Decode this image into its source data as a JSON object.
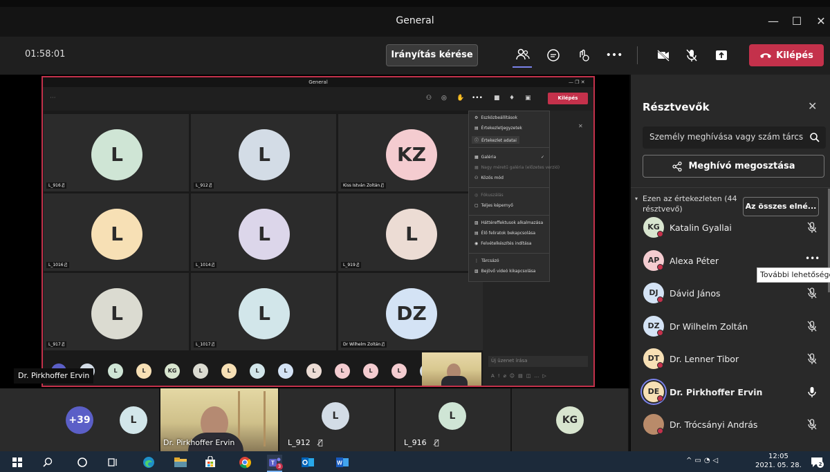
{
  "window": {
    "title": "General"
  },
  "toolbar": {
    "timer": "01:58:01",
    "control_request_label": "Irányítás kérése",
    "more_label": "•••",
    "leave_label": "Kilépés"
  },
  "shared_screen": {
    "title": "General",
    "leave_label": "Kilépés",
    "tiles": [
      {
        "initials": "L",
        "name": "L_916",
        "color": "#cfe5d5"
      },
      {
        "initials": "L",
        "name": "L_912",
        "color": "#d3dce6"
      },
      {
        "initials": "KZ",
        "name": "Kiss István Zoltán",
        "color": "#f4ccd0"
      },
      {
        "initials": "L",
        "name": "L_1016",
        "color": "#f7e0b5"
      },
      {
        "initials": "L",
        "name": "L_1014",
        "color": "#dcd6ea"
      },
      {
        "initials": "L",
        "name": "L_919",
        "color": "#ecdcd4"
      },
      {
        "initials": "L",
        "name": "L_917",
        "color": "#dbdbd1"
      },
      {
        "initials": "L",
        "name": "L_1017",
        "color": "#d2e6ea"
      },
      {
        "initials": "DZ",
        "name": "Dr Wilhelm Zoltán",
        "color": "#d4e3f5"
      }
    ],
    "menu_items": [
      "Eszközbeállítások",
      "Értekezletjegyzetek",
      "Értekezlet adatai",
      "Galéria",
      "Nagy méretű galéria (előzetes verzió)",
      "Közös mód",
      "Fókuszálás",
      "Teljes képernyő",
      "Háttéreffektusok alkalmazása",
      "Élő feliratok bekapcsolása",
      "Felvételkészítés indítása",
      "Tárcsázó",
      "Bejövő videó kikapcsolása"
    ],
    "chat_placeholder": "Új üzenet írása"
  },
  "presenter_label": "Dr. Pirkhoffer Ervin",
  "bottom_strip": {
    "overflow_count": "+39",
    "tile_1_initials": "L",
    "video_name": "Dr. Pirkhoffer Ervin",
    "tile_2": {
      "initials": "L",
      "name": "L_912"
    },
    "tile_3": {
      "initials": "L",
      "name": "L_916"
    },
    "tile_4_initials": "KG"
  },
  "panel": {
    "title": "Résztvevők",
    "search_placeholder": "Személy meghívása vagy szám tárcsázása",
    "share_label": "Meghívó megosztása",
    "section_label": "Ezen az értekezleten (44 résztvevő)",
    "all_button": "Az összes elné...",
    "tooltip": "További lehetőségek",
    "participants": [
      {
        "initials": "KG",
        "name": "Katalin Gyallai",
        "color": "#d8e5cf",
        "mic": "muted"
      },
      {
        "initials": "AP",
        "name": "Alexa Péter",
        "color": "#f4ccd0",
        "mic": "more"
      },
      {
        "initials": "DJ",
        "name": "Dávid János",
        "color": "#d4e3f5",
        "mic": "muted"
      },
      {
        "initials": "DZ",
        "name": "Dr Wilhelm Zoltán",
        "color": "#d4e3f5",
        "mic": "muted"
      },
      {
        "initials": "DT",
        "name": "Dr. Lenner Tibor",
        "color": "#f7e0b5",
        "mic": "muted"
      },
      {
        "initials": "DE",
        "name": "Dr. Pirkhoffer Ervin",
        "color": "#f7e0b5",
        "mic": "on"
      },
      {
        "initials": "",
        "name": "Dr. Trócsányi András",
        "color": "#b98b6a",
        "mic": "muted"
      }
    ]
  },
  "taskbar": {
    "time": "12:05",
    "date": "2021. 05. 28.",
    "teams_badge": "3",
    "notif_badge": "2"
  }
}
